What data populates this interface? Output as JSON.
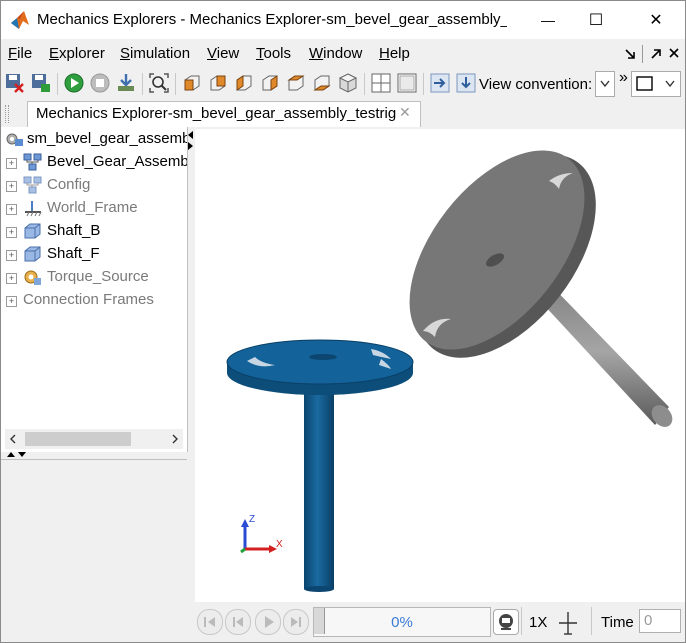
{
  "window": {
    "title": "Mechanics Explorers - Mechanics Explorer-sm_bevel_gear_assembly_t...",
    "minimize_glyph": "—",
    "maximize_glyph": "☐",
    "close_glyph": "✕"
  },
  "menu": {
    "items": [
      {
        "underline": "F",
        "rest": "ile"
      },
      {
        "underline": "E",
        "rest": "xplorer"
      },
      {
        "underline": "S",
        "rest": "imulation"
      },
      {
        "underline": "V",
        "rest": "iew"
      },
      {
        "underline": "T",
        "rest": "ools"
      },
      {
        "underline": "W",
        "rest": "indow"
      },
      {
        "underline": "H",
        "rest": "elp"
      }
    ]
  },
  "toolbar": {
    "view_convention_label": "View convention:",
    "overflow_glyph": "»"
  },
  "tab": {
    "label": "Mechanics Explorer-sm_bevel_gear_assembly_testrig",
    "close_glyph": "✕"
  },
  "tree": {
    "root": "sm_bevel_gear_assembl",
    "items": [
      {
        "label": "Bevel_Gear_Assembly",
        "icon": "subsystem-icon",
        "muted": false
      },
      {
        "label": "Config",
        "icon": "subsystem-icon",
        "muted": true
      },
      {
        "label": "World_Frame",
        "icon": "ground-icon",
        "muted": true
      },
      {
        "label": "Shaft_B",
        "icon": "solid-block-icon",
        "muted": false
      },
      {
        "label": "Shaft_F",
        "icon": "solid-block-icon",
        "muted": false
      },
      {
        "label": "Torque_Source",
        "icon": "source-icon",
        "muted": true
      }
    ],
    "connection_frames": "Connection Frames"
  },
  "axes_triad": {
    "z": "Z",
    "x": "X"
  },
  "playback": {
    "progress_percent": 0,
    "progress_text": "0%",
    "rate_label": "1X",
    "time_label": "Time",
    "time_value": "0"
  },
  "colors": {
    "blue_part": "#0f5584",
    "gray_part": "#6b6b6b",
    "progress_text": "#3a7bd5"
  }
}
